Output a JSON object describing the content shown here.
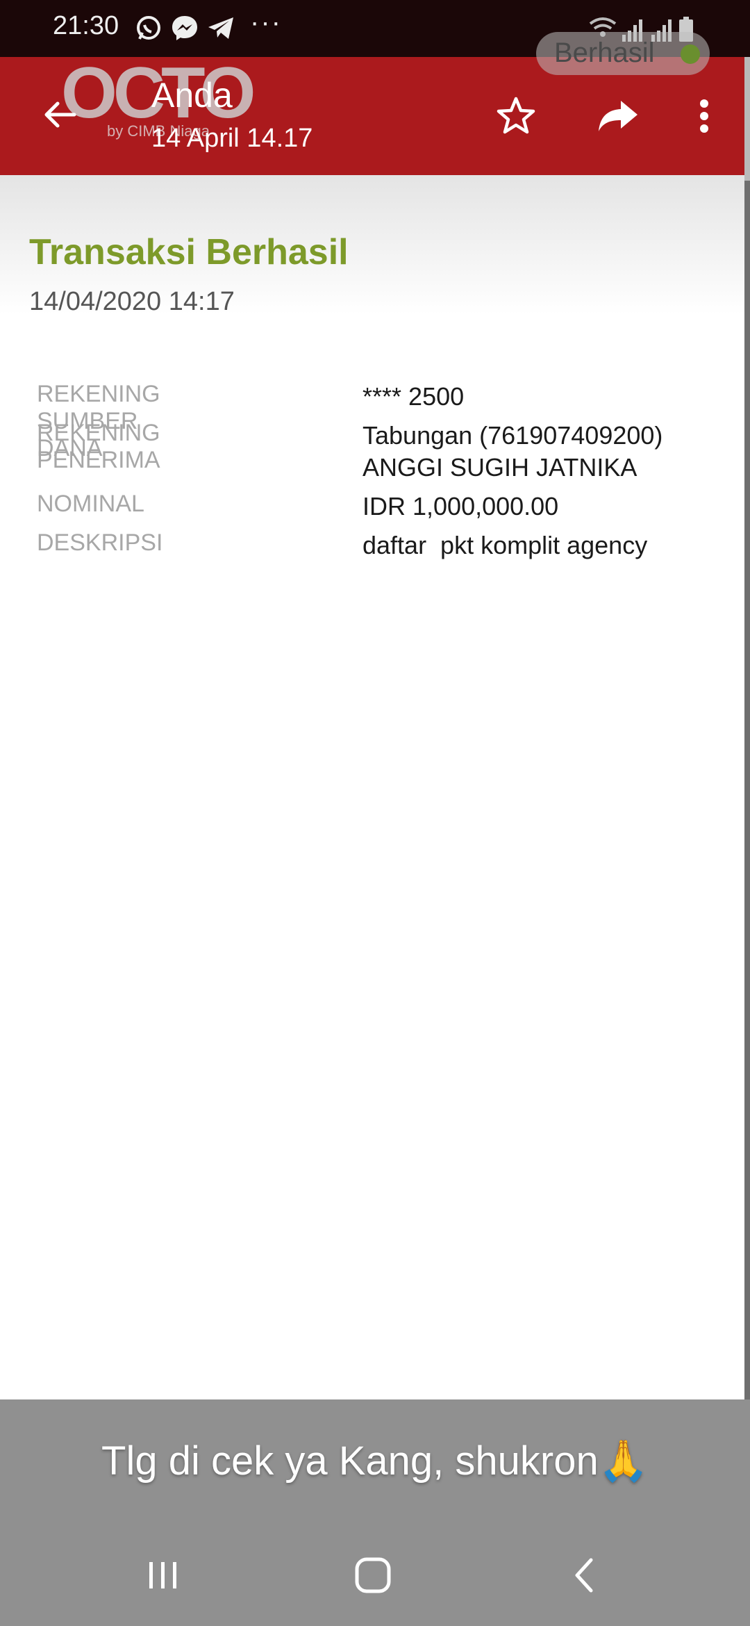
{
  "status_bar": {
    "time": "21:30",
    "overflow": "···",
    "icons": [
      "whatsapp-icon",
      "messenger-icon",
      "telegram-icon",
      "wifi-icon",
      "signal-icon",
      "signal-icon",
      "battery-icon"
    ]
  },
  "viewer": {
    "sender_name": "Anda",
    "sender_date": "14 April 14.17",
    "actions": [
      "back-arrow-icon",
      "star-icon",
      "share-forward-icon",
      "more-vert-icon"
    ]
  },
  "receipt": {
    "logo_text": "OCTO",
    "logo_sub": "by CIMB Niaga",
    "status_pill": "Berhasil",
    "title": "Transaksi Berhasil",
    "datetime": "14/04/2020 14:17",
    "brand_color": "#ab1a1d",
    "title_color": "#7d9a2a",
    "rows": [
      {
        "label": "REKENING SUMBER DANA",
        "value": "**** 2500"
      },
      {
        "label": "REKENING PENERIMA",
        "value": "Tabungan (761907409200)",
        "value2": "ANGGI SUGIH JATNIKA"
      },
      {
        "label": "NOMINAL",
        "value": "IDR 1,000,000.00"
      },
      {
        "label": "DESKRIPSI",
        "value": "daftar  pkt komplit agency"
      }
    ]
  },
  "caption": "Tlg di cek ya Kang, shukron🙏",
  "nav": [
    "recents-icon",
    "home-icon",
    "back-icon"
  ]
}
